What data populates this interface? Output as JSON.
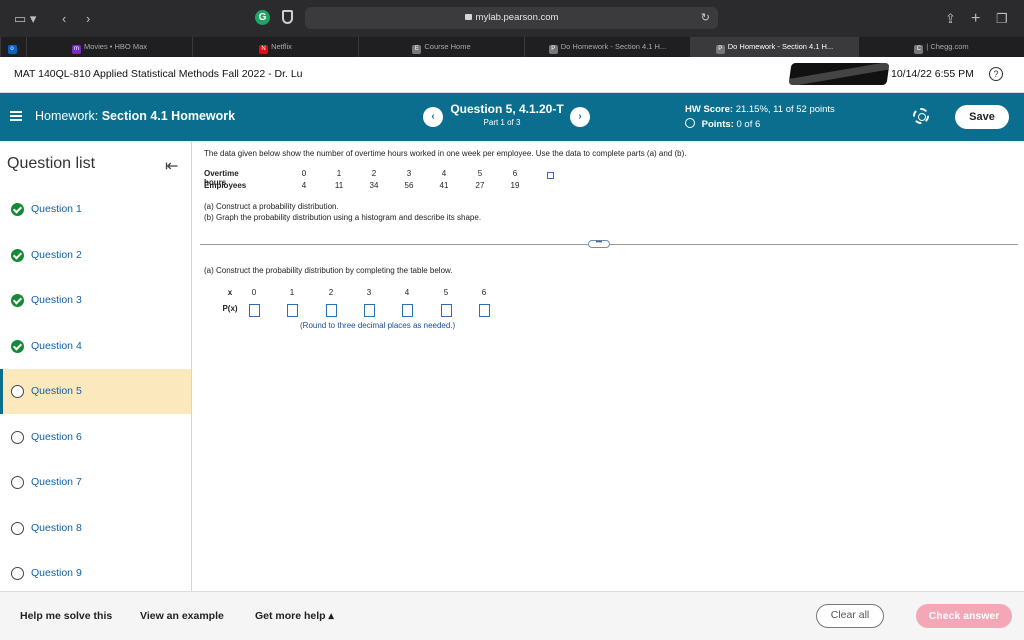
{
  "browser": {
    "address": "mylab.pearson.com",
    "tabs": [
      {
        "label": "Movies • HBO Max",
        "fav": "m",
        "color": "#7b2cbf"
      },
      {
        "label": "Netflix",
        "fav": "N",
        "color": "#e50914"
      },
      {
        "label": "Course Home",
        "fav": "E",
        "color": "#666"
      },
      {
        "label": "Do Homework - Section 4.1 H...",
        "fav": "P",
        "color": "#666"
      },
      {
        "label": "Do Homework - Section 4.1 H...",
        "fav": "P",
        "color": "#666"
      },
      {
        "label": "| Chegg.com",
        "fav": "C",
        "color": "#666"
      }
    ]
  },
  "course": {
    "title": "MAT 140QL-810 Applied Statistical Methods Fall 2022 - Dr. Lu",
    "datetime": "10/14/22 6:55 PM",
    "help_glyph": "?"
  },
  "hwbar": {
    "prefix": "Homework:",
    "name": "Section 4.1 Homework",
    "question": "Question 5, 4.1.20-T",
    "part": "Part 1 of 3",
    "score_label": "HW Score:",
    "score_value": "21.15%, 11 of 52 points",
    "points_label": "Points:",
    "points_value": "0 of 6",
    "save": "Save",
    "prev_glyph": "‹",
    "next_glyph": "›"
  },
  "sidebar": {
    "title": "Question list",
    "collapse_glyph": "⇤",
    "questions": [
      {
        "label": "Question 1",
        "state": "done"
      },
      {
        "label": "Question 2",
        "state": "done"
      },
      {
        "label": "Question 3",
        "state": "done"
      },
      {
        "label": "Question 4",
        "state": "done"
      },
      {
        "label": "Question 5",
        "state": "current"
      },
      {
        "label": "Question 6",
        "state": "open"
      },
      {
        "label": "Question 7",
        "state": "open"
      },
      {
        "label": "Question 8",
        "state": "open"
      },
      {
        "label": "Question 9",
        "state": "open"
      }
    ]
  },
  "problem": {
    "prompt": "The data given below show the number of overtime hours worked in one week per employee. Use the data to complete parts (a) and (b).",
    "row1_label": "Overtime hours",
    "row2_label": "Employees",
    "hours": [
      "0",
      "1",
      "2",
      "3",
      "4",
      "5",
      "6"
    ],
    "employees": [
      "4",
      "11",
      "34",
      "56",
      "41",
      "27",
      "19"
    ],
    "part_a": "(a) Construct a probability distribution.",
    "part_b": "(b) Graph the probability distribution using a histogram and describe its shape.",
    "expand_glyph": "•••",
    "construct": "(a) Construct the probability distribution by completing the table below.",
    "x_label": "x",
    "p_label": "P(x)",
    "x_values": [
      "0",
      "1",
      "2",
      "3",
      "4",
      "5",
      "6"
    ],
    "round_note": "(Round to three decimal places as needed.)"
  },
  "footer": {
    "help_solve": "Help me solve this",
    "example": "View an example",
    "more_help": "Get more help ▴",
    "clear": "Clear all",
    "check": "Check answer"
  }
}
